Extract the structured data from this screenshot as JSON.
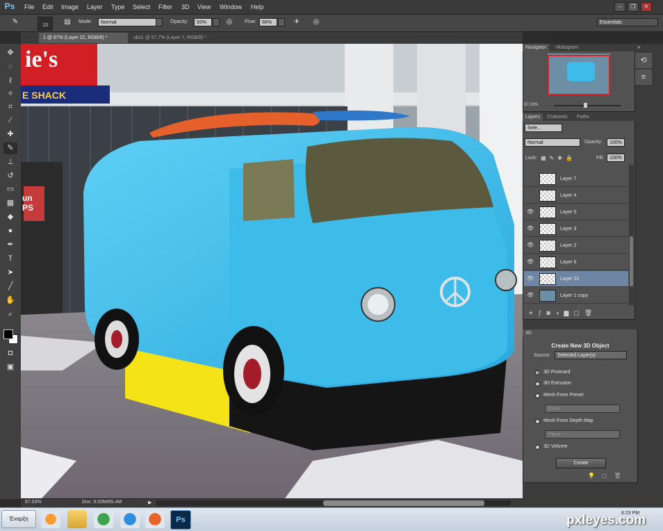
{
  "app": {
    "logo": "Ps"
  },
  "menu": [
    "File",
    "Edit",
    "Image",
    "Layer",
    "Type",
    "Select",
    "Filter",
    "3D",
    "View",
    "Window",
    "Help"
  ],
  "options": {
    "brush_size": "13",
    "mode_label": "Mode:",
    "mode_value": "Normal",
    "opacity_label": "Opacity:",
    "opacity_value": "93%",
    "flow_label": "Flow:",
    "flow_value": "66%",
    "workspace": "Essentials"
  },
  "tabs": [
    {
      "label": "1 @ 67% (Layer 22, RGB/8) *",
      "active": true
    },
    {
      "label": "sbs1 @ 57.7% (Layer 7, RGB/8) *",
      "active": false
    }
  ],
  "canvas": {
    "sign_text": "ie's",
    "sign_text2": "E SHACK",
    "side_sign": "un PS"
  },
  "status": {
    "zoom": "67.03%",
    "doc": "Doc: 9.00M/65.4M"
  },
  "navigator": {
    "tabs": [
      "Navigator",
      "Histogram"
    ],
    "zoom": "67.03%"
  },
  "layers_panel": {
    "tabs": [
      "Layers",
      "Channels",
      "Paths"
    ],
    "filter": "Sele...",
    "blend": "Normal",
    "opacity_label": "Opacity:",
    "opacity_value": "100%",
    "lock_label": "Lock:",
    "fill_label": "Fill:",
    "fill_value": "100%",
    "layers": [
      {
        "name": "Layer 7",
        "visible": false
      },
      {
        "name": "Layer 4",
        "visible": false
      },
      {
        "name": "Layer 5",
        "visible": true
      },
      {
        "name": "Layer 3",
        "visible": true
      },
      {
        "name": "Layer 2",
        "visible": true
      },
      {
        "name": "Layer 6",
        "visible": true
      },
      {
        "name": "Layer 22",
        "visible": true,
        "selected": true
      },
      {
        "name": "Layer 1 copy",
        "visible": true
      }
    ]
  },
  "panel3d": {
    "tab": "3D",
    "title": "Create New 3D Object",
    "source_label": "Source:",
    "source_value": "Selected Layer(s)",
    "options": [
      "3D Postcard",
      "3D Extrusion",
      "Mesh From Preset",
      "Mesh From Depth Map",
      "3D Volume"
    ],
    "preset_value": "Cone",
    "depth_value": "Plane",
    "create_label": "Create"
  },
  "taskbar": {
    "start_label": "Έναρξη",
    "time": "6:23 PM"
  },
  "watermark": "pxleyes.com"
}
